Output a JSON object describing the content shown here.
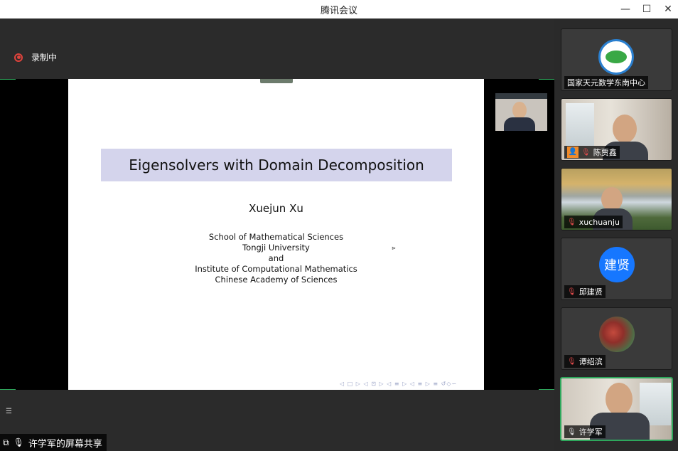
{
  "window": {
    "title": "腾讯会议",
    "minimize_icon": "minimize-icon",
    "maximize_icon": "maximize-icon",
    "close_icon": "close-icon"
  },
  "recording": {
    "label": "录制中"
  },
  "slide": {
    "title": "Eigensolvers with Domain Decomposition",
    "author": "Xuejun Xu",
    "affiliation_lines": [
      "School of Mathematical Sciences",
      "Tongji University",
      "and",
      "Institute of Computational Mathematics",
      "Chinese Academy of Sciences"
    ],
    "nav_symbols": "◁ □ ▷ ◁ ⊡ ▷ ◁ ≡ ▷ ◁ ≡ ▷   ≡   ↺◇∽",
    "cursor_mark": "⊳"
  },
  "share_status": {
    "label": "许学军的屏幕共享"
  },
  "participants": [
    {
      "name": "国家天元数学东南中心",
      "type": "logo",
      "mic": "none"
    },
    {
      "name": "陈贾鑫",
      "type": "camera",
      "mic": "muted",
      "host": true
    },
    {
      "name": "xuchuanju",
      "type": "camera-waterfall",
      "mic": "muted"
    },
    {
      "name": "邱建贤",
      "type": "avatar",
      "avatar_text": "建贤",
      "mic": "muted"
    },
    {
      "name": "谭绍滨",
      "type": "photo",
      "mic": "muted"
    },
    {
      "name": "许学军",
      "type": "camera",
      "mic": "on",
      "active": true
    }
  ],
  "colors": {
    "accent_green": "#2ea85c",
    "record_red": "#e0433c",
    "avatar_blue": "#1677ff",
    "slide_title_bg": "#d4d4ec"
  }
}
